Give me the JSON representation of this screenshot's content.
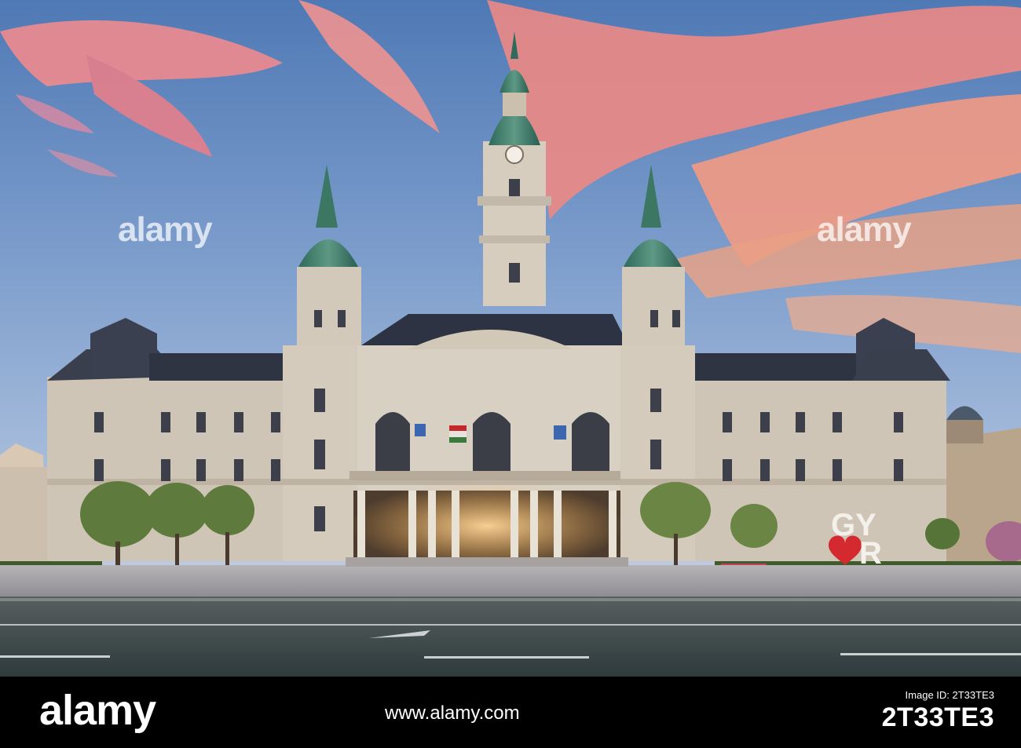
{
  "watermark": {
    "text": "alamy"
  },
  "sign": {
    "text_top": "GY",
    "text_bottom": "R"
  },
  "footer": {
    "logo": "alamy",
    "image_id_label": "Image ID: 2T33TE3",
    "url": "www.alamy.com",
    "image_id": "2T33TE3"
  },
  "colors": {
    "sky_top": "#5f86bf",
    "sky_pink": "#ef8f8a",
    "facade": "#cfc7bc",
    "roof": "#2e3446",
    "dome": "#3f7d6b",
    "road": "#3d4a4c"
  }
}
